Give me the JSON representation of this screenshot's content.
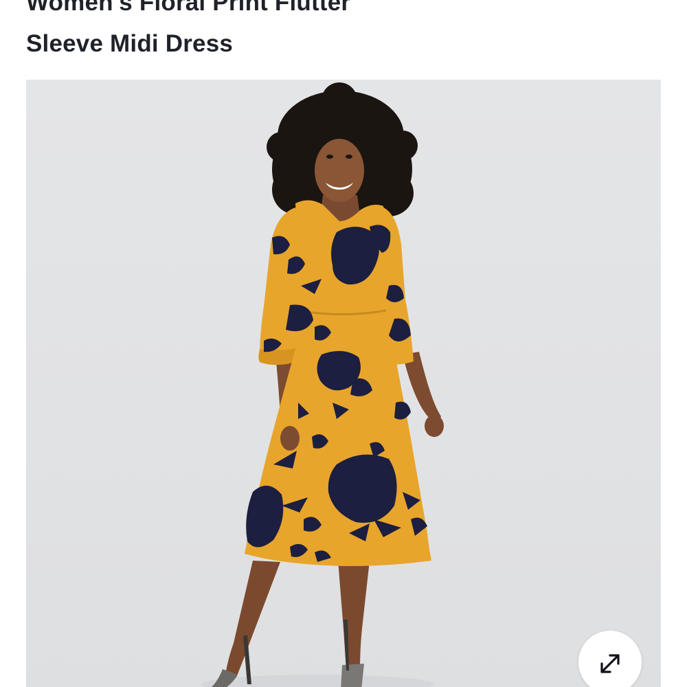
{
  "product": {
    "title_line_1": "Women's Floral Print Flutter",
    "title_line_2": "Sleeve Midi Dress",
    "image": {
      "subject": "woman-in-floral-dress-photo",
      "background_color": "#e2e3e5",
      "dress_color": "#e8a52c",
      "print_color": "#1c1f3f"
    },
    "expand_button": {
      "icon": "expand-arrows-icon"
    }
  }
}
